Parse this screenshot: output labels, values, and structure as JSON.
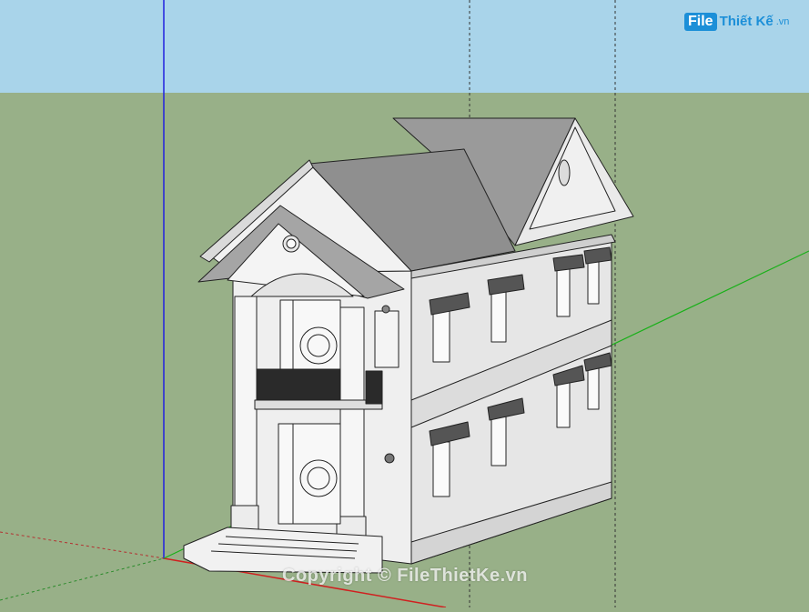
{
  "app": {
    "viewport_type": "3D modeling viewport",
    "colors": {
      "sky": "#a9d4ea",
      "ground": "#98b088",
      "wall": "#ededed",
      "roof": "#8f8f8f",
      "axis_red": "#d02020",
      "axis_green": "#19b019",
      "axis_blue": "#2020e0"
    }
  },
  "watermark": {
    "logo_box": "File",
    "logo_text": "Thiết Kế",
    "logo_suffix": ".vn",
    "copyright": "Copyright © FileThietKe.vn"
  }
}
